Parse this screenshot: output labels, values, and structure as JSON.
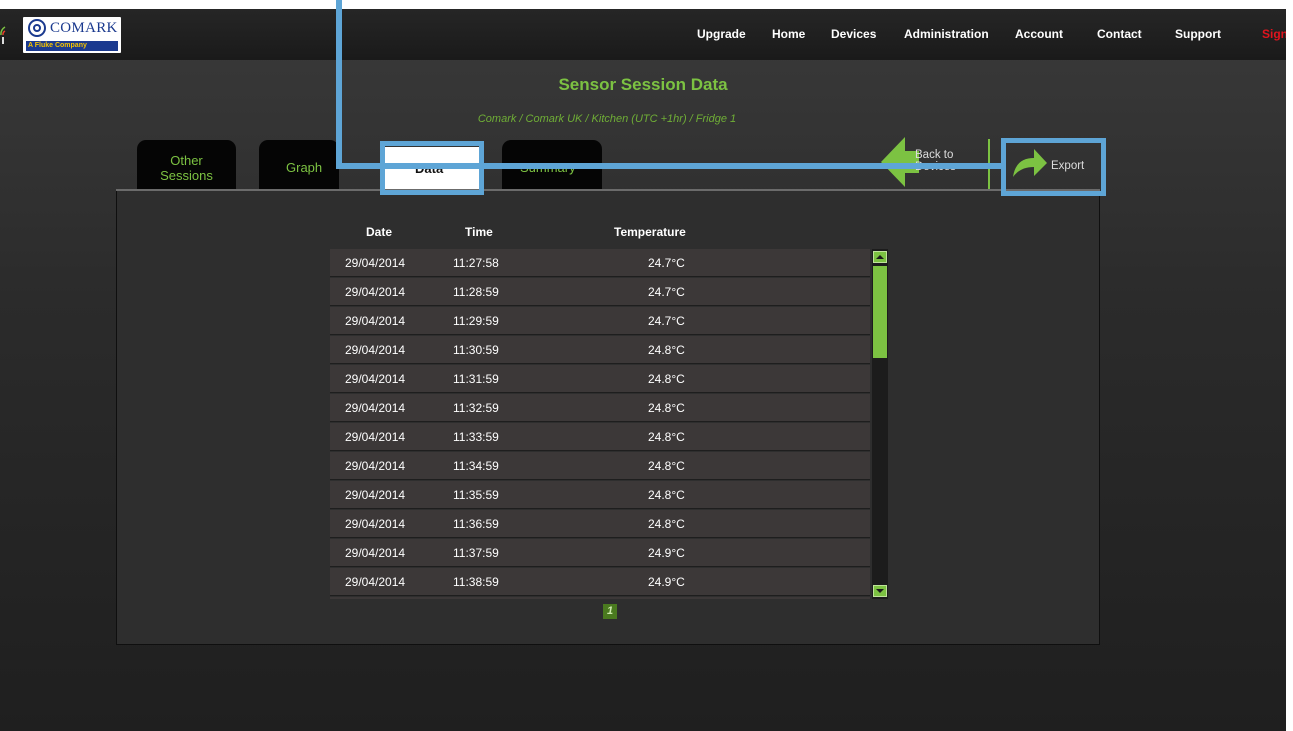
{
  "nav": {
    "logo_text": "COMARK",
    "logo_sub": "A Fluke Company",
    "items": [
      "Upgrade",
      "Home",
      "Devices",
      "Administration",
      "Account",
      "Contact",
      "Support"
    ],
    "signout": "Sign"
  },
  "page": {
    "title": "Sensor Session Data",
    "breadcrumb": "Comark  / Comark UK  / Kitchen  (UTC +1hr) / Fridge 1"
  },
  "tabs": {
    "other_line1": "Other",
    "other_line2": "Sessions",
    "graph": "Graph",
    "data": "Data",
    "summary": "Summary"
  },
  "actions": {
    "back_line1": "Back to",
    "back_line2": "Devices",
    "export": "Export"
  },
  "table": {
    "headers": [
      "Date",
      "Time",
      "Temperature"
    ],
    "rows": [
      [
        "29/04/2014",
        "11:27:58",
        "24.7°C"
      ],
      [
        "29/04/2014",
        "11:28:59",
        "24.7°C"
      ],
      [
        "29/04/2014",
        "11:29:59",
        "24.7°C"
      ],
      [
        "29/04/2014",
        "11:30:59",
        "24.8°C"
      ],
      [
        "29/04/2014",
        "11:31:59",
        "24.8°C"
      ],
      [
        "29/04/2014",
        "11:32:59",
        "24.8°C"
      ],
      [
        "29/04/2014",
        "11:33:59",
        "24.8°C"
      ],
      [
        "29/04/2014",
        "11:34:59",
        "24.8°C"
      ],
      [
        "29/04/2014",
        "11:35:59",
        "24.8°C"
      ],
      [
        "29/04/2014",
        "11:36:59",
        "24.8°C"
      ],
      [
        "29/04/2014",
        "11:37:59",
        "24.9°C"
      ],
      [
        "29/04/2014",
        "11:38:59",
        "24.9°C"
      ]
    ]
  },
  "pagination": {
    "current": "1"
  },
  "colors": {
    "accent_green": "#7cc242",
    "highlight_blue": "#5ea5d6",
    "signout_red": "#e0141e"
  }
}
